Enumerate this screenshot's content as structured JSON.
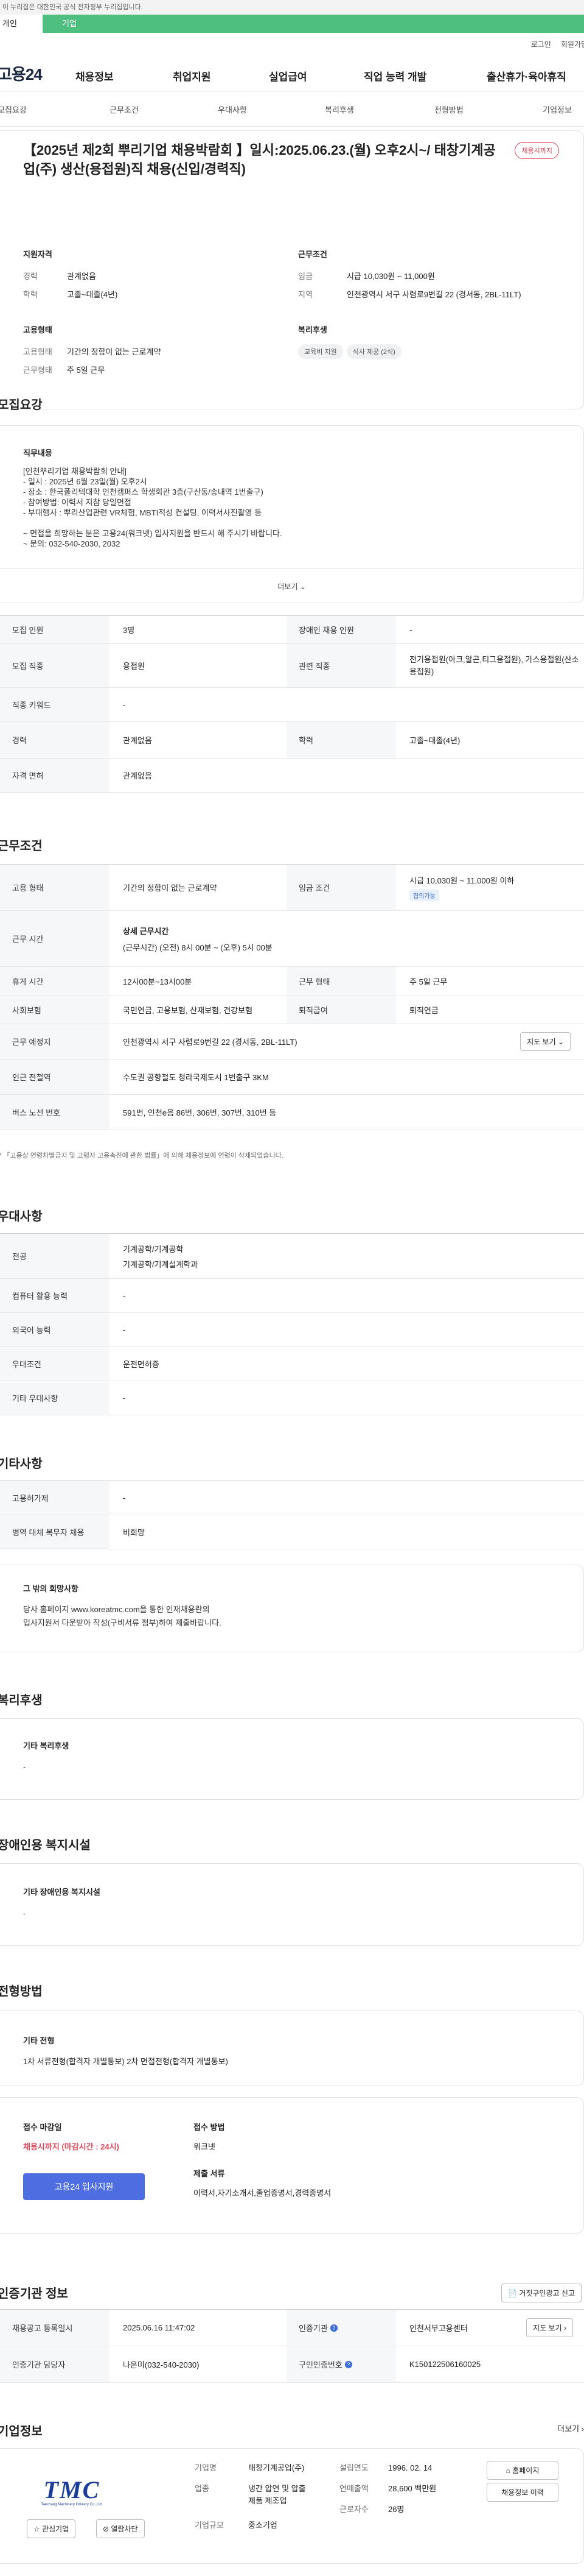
{
  "gov_notice": "이 누리집은 대한민국 공식 전자정부 누리집입니다.",
  "top_tabs": {
    "personal": "개인",
    "company": "기업"
  },
  "util": {
    "login": "로그인",
    "join": "회원가입"
  },
  "logo": "고용24",
  "gnb": [
    "채용정보",
    "취업지원",
    "실업급여",
    "직업 능력 개발",
    "출산휴가·육아휴직"
  ],
  "subnav": [
    "모집요강",
    "근무조건",
    "우대사항",
    "복리후생",
    "전형방법",
    "기업정보"
  ],
  "header": {
    "title": "【2025년 제2회 뿌리기업 채용박람회 】일시:2025.06.23.(월) 오후2시~/ 태창기계공업(주) 생산(용접원)직 채용(신입/경력직)",
    "badge": "채용시까지",
    "qual_title": "지원자격",
    "career_k": "경력",
    "career_v": "관계없음",
    "edu_k": "학력",
    "edu_v": "고졸~대졸(4년)",
    "emp_title": "고용형태",
    "emptype_k": "고용형태",
    "emptype_v": "기간의 정함이 없는 근로계약",
    "worktype_k": "근무형태",
    "worktype_v": "주 5일 근무",
    "cond_title": "근무조건",
    "wage_k": "임금",
    "wage_v": "시급 10,030원 ~ 11,000원",
    "region_k": "지역",
    "region_v": "인천광역시 서구 사렴로9번길 22 (경서동, 2BL-11LT)",
    "welfare_title": "복리후생",
    "welfare_chips": [
      "교육비 지원",
      "식사 제공 (2식)"
    ]
  },
  "recruit": {
    "heading": "모집요강",
    "job_title": "직무내용",
    "job_lines": [
      "[인천뿌리기업 채용박람회 안내]",
      "- 일시 : 2025년 6월 23일(월) 오후2시",
      "- 장소 : 한국폴리텍대학 인천캠퍼스 학생회관 3층(구산동/송내역 1번출구)",
      "- 참여방법: 이력서 지참 당일면접",
      "- 부대행사 : 뿌리산업관련 VR체험, MBTI적성 컨설팅, 이력서사진촬영 등",
      "",
      "~ 면접을 희망하는 분은 고용24(워크넷) 입사지원을 반드시 해 주시기 바랍니다.",
      "~ 문의: 032-540-2030, 2032"
    ],
    "more": "더보기 ⌄",
    "rows": {
      "headcount_k": "모집 인원",
      "headcount_v": "3명",
      "disabled_k": "장애인 채용 인원",
      "disabled_v": "-",
      "occupation_k": "모집 직종",
      "occupation_v": "용접원",
      "related_k": "관련 직종",
      "related_v": "전기용접원(아크,알곤,티그용접원), 가스용접원(산소용접원)",
      "keyword_k": "직종 키워드",
      "keyword_v": "-",
      "career_k": "경력",
      "career_v": "관계없음",
      "edu_k": "학력",
      "edu_v": "고졸~대졸(4년)",
      "license_k": "자격 면허",
      "license_v": "관계없음"
    }
  },
  "work": {
    "heading": "근무조건",
    "emptype_k": "고용 형태",
    "emptype_v": "기간의 정함이 없는 근로계약",
    "wage_k": "임금 조건",
    "wage_v": "시급 10,030원 ~ 11,000원 이하",
    "wage_tag": "협의가능",
    "hours_k": "근무 시간",
    "hours_t": "상세 근무시간",
    "hours_v": "(근무시간) (오전) 8시 00분 ~ (오후) 5시 00분",
    "break_k": "휴게 시간",
    "break_v": "12시00분~13시00분",
    "form_k": "근무 형태",
    "form_v": "주 5일 근무",
    "insure_k": "사회보험",
    "insure_v": "국민연금, 고용보험, 산재보험, 건강보험",
    "pension_k": "퇴직급여",
    "pension_v": "퇴직연금",
    "place_k": "근무 예정지",
    "place_v": "인천광역시 서구 사렴로9번길 22 (경서동, 2BL-11LT)",
    "map_btn": "지도 보기 ⌄",
    "subway_k": "인근 전철역",
    "subway_v": "수도권 공항철도 청라국제도시 1번출구 3KM",
    "bus_k": "버스 노선 번호",
    "bus_v": "591번, 인천e음 86번, 306번, 307번, 310번 등",
    "note": "* 「고용상 연령차별금지 및 고령자 고용촉진에 관한 법률」에 의해 채용정보에 연령이 삭제되었습니다."
  },
  "pref": {
    "heading": "우대사항",
    "major_k": "전공",
    "major_v1": "기계공학/기계공학",
    "major_v2": "기계공학/기계설계학과",
    "pc_k": "컴퓨터 활용 능력",
    "pc_v": "-",
    "lang_k": "외국어 능력",
    "lang_v": "-",
    "cond_k": "우대조건",
    "cond_v": "운전면허증",
    "etc_k": "기타 우대사항",
    "etc_v": "-"
  },
  "etc": {
    "heading": "기타사항",
    "subsidy_k": "고용허가제",
    "subsidy_v": "-",
    "military_k": "병역 대체 복무자 채용",
    "military_v": "비희망",
    "other_title": "그 밖의 희망사항",
    "other_v1": "당사 홈페이지 www.koreatmc.com을 통한 인재채용란의",
    "other_v2": "입사지원서 다운받아 작성(구비서류 첨부)하여 제출바랍니다."
  },
  "welfare": {
    "heading": "복리후생",
    "title": "기타 복리후생",
    "value": "-"
  },
  "disabled": {
    "heading": "장애인용 복지시설",
    "title": "기타 장애인용 복지시설",
    "value": "-"
  },
  "process": {
    "heading": "전형방법",
    "title": "기타 전형",
    "value": "1차 서류전형(합격자 개별통보) 2차 면접전형(합격자 개별통보)",
    "deadline_t": "접수 마감일",
    "deadline_v": "채용시까지 (마감시간 : 24시)",
    "apply_btn": "고용24 입사지원",
    "method_t": "접수 방법",
    "method_v": "워크넷",
    "docs_t": "제출 서류",
    "docs_v": "이력서,자기소개서,졸업증명서,경력증명서"
  },
  "agency": {
    "heading": "인증기관 정보",
    "report_btn": "거짓구인광고 신고",
    "reg_k": "채용공고 등록일시",
    "reg_v": "2025.06.16 11:47:02",
    "org_k": "인증기관",
    "org_v": "인천서부고용센터",
    "org_btn": "지도 보기",
    "mgr_k": "인증기관 담당자",
    "mgr_v": "나은미(032-540-2030)",
    "num_k": "구인인증번호",
    "num_v": "K150122506160025"
  },
  "company": {
    "heading": "기업정보",
    "more": "더보기 ›",
    "logo_text": "TMC",
    "logo_sub": "Taechang Machinery Industry Co.,Ltd.",
    "fav_btn": "☆ 관심기업",
    "block_btn": "⊘ 열람차단",
    "name_k": "기업명",
    "name_v": "태창기계공업(주)",
    "founded_k": "설립연도",
    "founded_v": "1996. 02. 14",
    "home_btn": "홈페이지",
    "biz_k": "업종",
    "biz_v1": "냉간 압연 및 압출",
    "biz_v2": "제품 제조업",
    "sales_k": "연매출액",
    "sales_v": "28,600 백만원",
    "list_btn": "채용정보 이력",
    "emp_k": "근로자수",
    "emp_v": "26명",
    "size_k": "기업규모",
    "size_v": "중소기업"
  }
}
